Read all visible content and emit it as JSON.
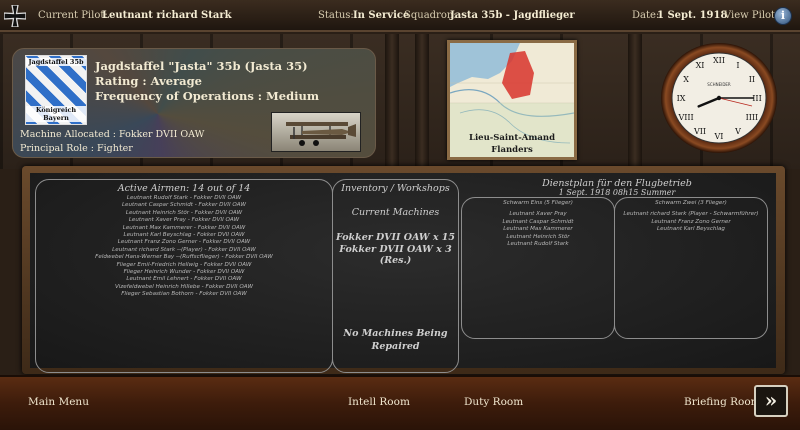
{
  "topbar": {
    "pilot_label": "Current Pilot:",
    "pilot_value": "Leutnant richard Stark",
    "status_label": "Status:",
    "status_value": "In Service",
    "squadron_label": "Squadron:",
    "squadron_value": "Jasta 35b - Jagdflieger",
    "date_label": "Date:",
    "date_value": "1 Sept. 1918",
    "view_pilot": "View Pilot",
    "info_glyph": "i"
  },
  "squadron": {
    "emblem_top": "Jagdstaffel 35b",
    "emblem_bottom": "Königreich Bayern",
    "name": "Jagdstaffel \"Jasta\" 35b (Jasta 35)",
    "rating": "Rating : Average",
    "frequency": "Frequency of Operations : Medium",
    "machine": "Machine Allocated : Fokker DVII OAW",
    "role": "Principal Role : Fighter"
  },
  "map": {
    "location_line1": "Lieu-Saint-Amand",
    "location_line2": "Flanders"
  },
  "clock": {
    "hour": 8,
    "minute": 15,
    "face_text": "SCHNEIDER"
  },
  "airmen": {
    "title": "Active Airmen: 14 out of 14",
    "list": [
      "Leutnant Rudolf Stark - Fokker DVII OAW",
      "Leutnant Caspar Schmidt - Fokker DVII OAW",
      "Leutnant Heinrich Stör - Fokker DVII OAW",
      "Leutnant Xaver Pray - Fokker DVII OAW",
      "Leutnant Max Kammerer - Fokker DVII OAW",
      "Leutnant Karl Beyschlag - Fokker DVII OAW",
      "Leutnant Franz Zono Gerner - Fokker DVII OAW",
      "Leutnant richard Stark --(Player) - Fokker DVII OAW",
      "Feldwebel Hans-Werner Bay --(Ruffscflieger) - Fokker DVII OAW",
      "Flieger Emil-Friedrich Hellwig - Fokker DVII OAW",
      "Flieger Heinrich Wunder - Fokker DVII OAW",
      "Leutnant Emil Lehnert - Fokker DVII OAW",
      "Vizefeldwebel Heinrich Hillebe - Fokker DVII OAW",
      "Flieger Sebastian Bothorn - Fokker DVII OAW"
    ]
  },
  "inventory": {
    "title": "Inventory / Workshops",
    "current_label": "Current Machines",
    "machines": [
      "Fokker DVII OAW x 15",
      "Fokker DVII OAW x 3 (Res.)"
    ],
    "repair_line1": "No Machines Being",
    "repair_line2": "Repaired"
  },
  "duty": {
    "title": "Dienstplan für den Flugbetrieb",
    "subtitle": "1 Sept. 1918 08h15 Summer",
    "schwarm1": {
      "title": "Schwarm Eins (5 Flieger)",
      "members": [
        "Leutnant Xaver Pray",
        "Leutnant Caspar Schmidt",
        "Leutnant Max Kammerer",
        "Leutnant Heinrich Stör",
        "Leutnant Rudolf Stark"
      ]
    },
    "schwarm2": {
      "title": "Schwarm Zwei (3 Flieger)",
      "members": [
        "Leutnant richard Stark (Player - Schwarmführer)",
        "Leutnant Franz Zono Gerner",
        "Leutnant Karl Beyschlag"
      ]
    }
  },
  "bottom": {
    "main_menu": "Main Menu",
    "intell_room": "Intell Room",
    "duty_room": "Duty Room",
    "briefing_room": "Briefing Room",
    "next_glyph": "»"
  }
}
